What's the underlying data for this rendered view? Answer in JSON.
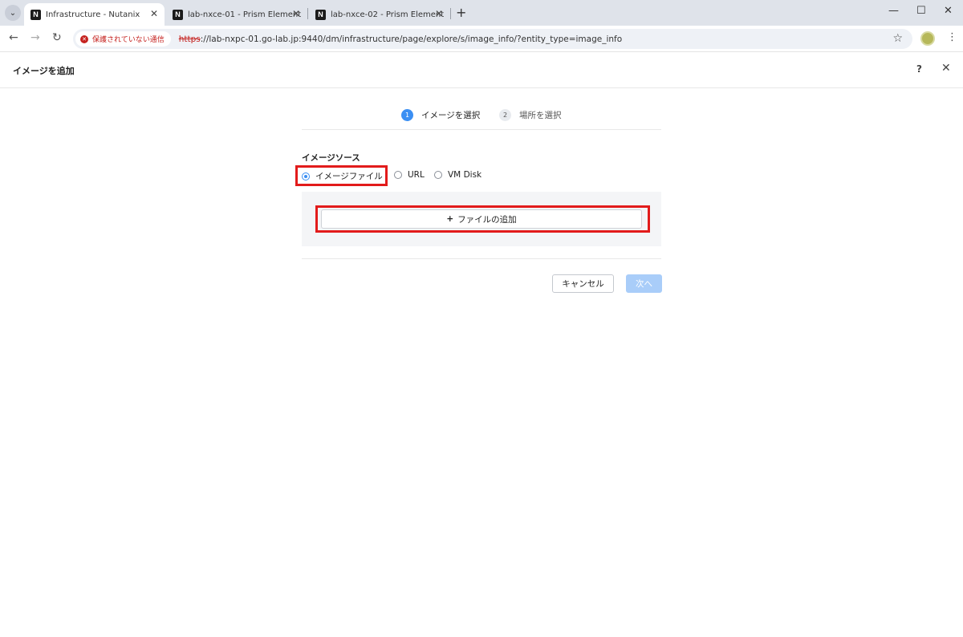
{
  "browser": {
    "tabs": [
      {
        "title": "Infrastructure - Nutanix",
        "favicon": "nutanix-icon",
        "active": true
      },
      {
        "title": "lab-nxce-01 - Prism Element",
        "favicon": "nutanix-icon",
        "active": false
      },
      {
        "title": "lab-nxce-02 - Prism Element",
        "favicon": "nutanix-icon",
        "active": false
      }
    ],
    "security_chip": "保護されていない通信",
    "url_scheme": "https",
    "url_rest": "://lab-nxpc-01.go-lab.jp:9440/dm/infrastructure/page/explore/s/image_info/?entity_type=image_info"
  },
  "header": {
    "title": "イメージを追加",
    "help": "?",
    "close": "✕"
  },
  "stepper": {
    "steps": [
      {
        "num": "1",
        "label": "イメージを選択",
        "state": "active"
      },
      {
        "num": "2",
        "label": "場所を選択",
        "state": "inactive"
      }
    ]
  },
  "form": {
    "source_label": "イメージソース",
    "options": [
      {
        "label": "イメージファイル",
        "checked": true
      },
      {
        "label": "URL",
        "checked": false
      },
      {
        "label": "VM Disk",
        "checked": false
      }
    ],
    "add_file_plus": "+",
    "add_file_label": "ファイルの追加"
  },
  "footer": {
    "cancel_label": "キャンセル",
    "next_label": "次へ"
  },
  "colors": {
    "accent": "#3b8ff3",
    "highlight": "#e21b1b",
    "next_disabled": "#a9cdf9"
  }
}
